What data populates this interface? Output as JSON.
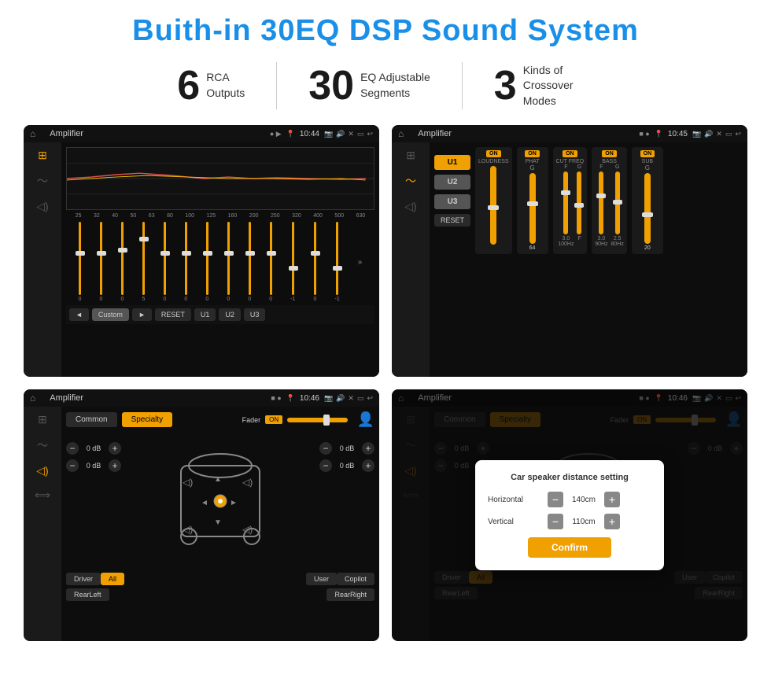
{
  "header": {
    "title": "Buith-in 30EQ DSP Sound System"
  },
  "stats": [
    {
      "number": "6",
      "text": "RCA\nOutputs"
    },
    {
      "number": "30",
      "text": "EQ Adjustable\nSegments"
    },
    {
      "number": "3",
      "text": "Kinds of\nCrossover Modes"
    }
  ],
  "screenshots": [
    {
      "id": "eq",
      "statusBar": {
        "appTitle": "Amplifier",
        "time": "10:44"
      },
      "freqLabels": [
        "25",
        "32",
        "40",
        "50",
        "63",
        "80",
        "100",
        "125",
        "160",
        "200",
        "250",
        "320",
        "400",
        "500",
        "630"
      ],
      "sliderValues": [
        "0",
        "0",
        "0",
        "5",
        "0",
        "0",
        "0",
        "0",
        "0",
        "0",
        "-1",
        "0",
        "-1"
      ],
      "bottomButtons": [
        "Custom",
        "RESET",
        "U1",
        "U2",
        "U3"
      ]
    },
    {
      "id": "crossover",
      "statusBar": {
        "appTitle": "Amplifier",
        "time": "10:45"
      },
      "uButtons": [
        "U1",
        "U2",
        "U3"
      ],
      "controls": [
        "LOUDNESS",
        "PHAT",
        "CUT FREQ",
        "BASS",
        "SUB"
      ],
      "resetLabel": "RESET"
    },
    {
      "id": "fader",
      "statusBar": {
        "appTitle": "Amplifier",
        "time": "10:46"
      },
      "tabs": [
        "Common",
        "Specialty"
      ],
      "faderLabel": "Fader",
      "onLabel": "ON",
      "dbValues": [
        "0 dB",
        "0 dB",
        "0 dB",
        "0 dB"
      ],
      "bottomButtons": [
        "Driver",
        "All",
        "User",
        "Copilot",
        "RearLeft",
        "RearRight"
      ]
    },
    {
      "id": "dialog",
      "statusBar": {
        "appTitle": "Amplifier",
        "time": "10:46"
      },
      "tabs": [
        "Common",
        "Specialty"
      ],
      "dialog": {
        "title": "Car speaker distance setting",
        "horizontalLabel": "Horizontal",
        "horizontalValue": "140cm",
        "verticalLabel": "Vertical",
        "verticalValue": "110cm",
        "confirmLabel": "Confirm"
      },
      "bottomButtons": [
        "Driver",
        "All",
        "User",
        "Copilot",
        "RearLeft",
        "RearRight"
      ],
      "dbValues": [
        "0 dB",
        "0 dB"
      ]
    }
  ]
}
